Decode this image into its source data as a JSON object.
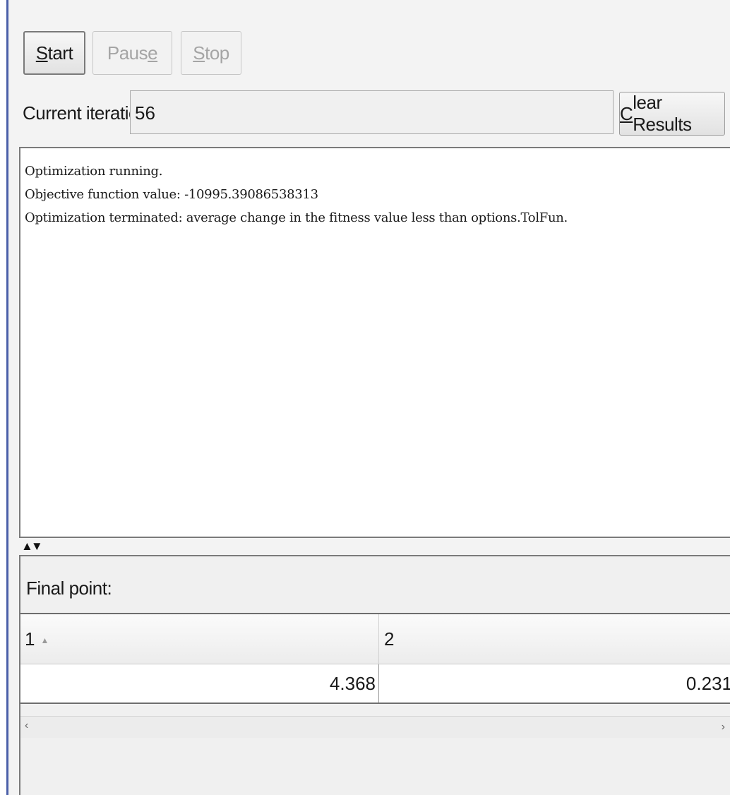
{
  "toolbar": {
    "start_mnemonic": "S",
    "start_rest": "tart",
    "pause_pre": "Paus",
    "pause_mnemonic": "e",
    "stop_mnemonic": "S",
    "stop_rest": "top"
  },
  "iteration": {
    "label": "Current iteration:",
    "value": "56"
  },
  "clear_button": {
    "mnemonic": "C",
    "rest": "lear Results"
  },
  "output": {
    "lines": [
      "Optimization running.",
      "Objective function value: -10995.39086538313",
      "Optimization terminated: average change in the fitness value less than options.TolFun."
    ]
  },
  "splitter": {
    "glyph": "▲▼"
  },
  "results": {
    "title": "Final point:",
    "columns": [
      "1",
      "2"
    ],
    "sort_glyph": "▲",
    "values": [
      "4.368",
      "0.231"
    ]
  },
  "scrollbar": {
    "left_glyph": "‹",
    "right_glyph": "›"
  }
}
